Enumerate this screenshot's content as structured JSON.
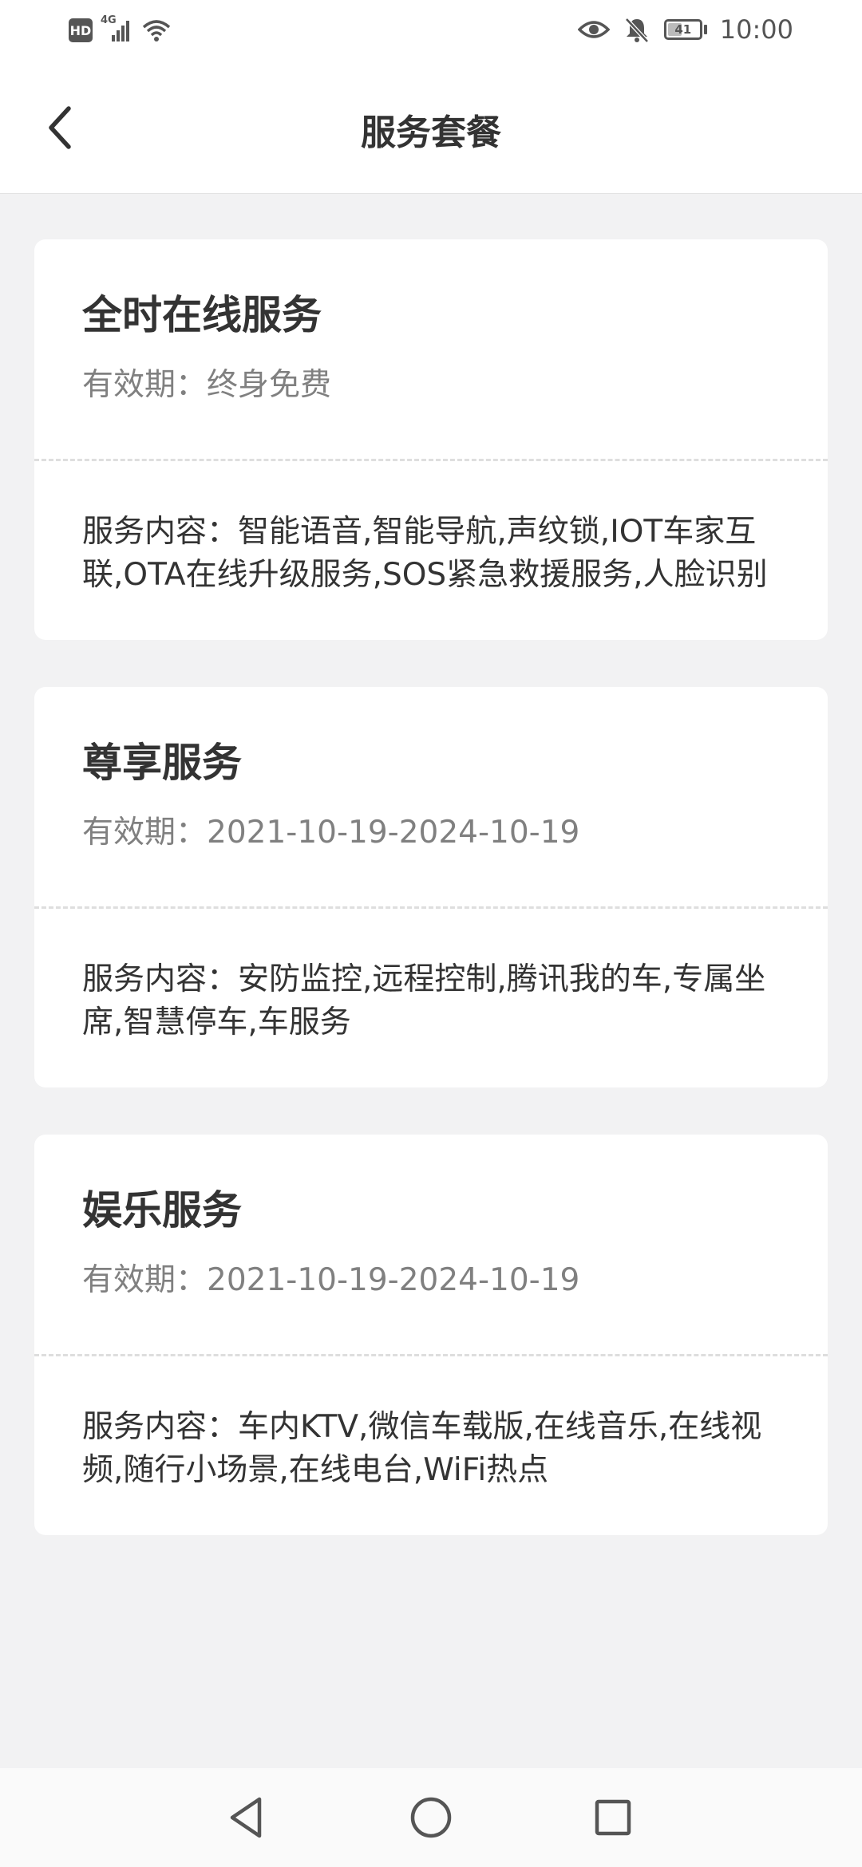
{
  "status_bar": {
    "hd_label": "HD",
    "network_label": "4G",
    "battery_level": "41",
    "time": "10:00",
    "icons": [
      "hd-icon",
      "signal-icon",
      "wifi-icon",
      "eye-icon",
      "bell-off-icon",
      "battery-icon"
    ]
  },
  "header": {
    "title": "服务套餐",
    "back_icon": "chevron-left-icon"
  },
  "packages": [
    {
      "title": "全时在线服务",
      "validity": "有效期：终身免费",
      "content": "服务内容：智能语音,智能导航,声纹锁,IOT车家互联,OTA在线升级服务,SOS紧急救援服务,人脸识别"
    },
    {
      "title": "尊享服务",
      "validity": "有效期：2021-10-19-2024-10-19",
      "content": "服务内容：安防监控,远程控制,腾讯我的车,专属坐席,智慧停车,车服务"
    },
    {
      "title": "娱乐服务",
      "validity": "有效期：2021-10-19-2024-10-19",
      "content": "服务内容：车内KTV,微信车载版,在线音乐,在线视频,随行小场景,在线电台,WiFi热点"
    }
  ],
  "system_nav": {
    "icons": [
      "back-triangle-icon",
      "home-circle-icon",
      "recents-square-icon"
    ]
  },
  "colors": {
    "background": "#f2f2f3",
    "card": "#ffffff",
    "title_text": "#333333",
    "secondary_text": "#808080",
    "divider": "#dedede"
  }
}
